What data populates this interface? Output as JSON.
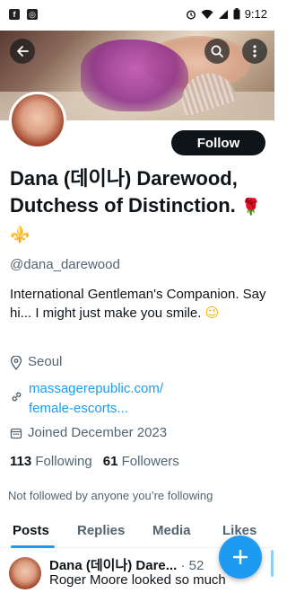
{
  "status_bar": {
    "time": "9:12",
    "left_icons": [
      "facebook-icon",
      "shield-app-icon"
    ],
    "right_icons": [
      "alarm-icon",
      "wifi-icon",
      "signal-icon",
      "battery-icon"
    ]
  },
  "header": {
    "back_icon": "arrow-left-icon",
    "search_icon": "search-icon",
    "more_icon": "more-vertical-icon"
  },
  "profile": {
    "display_name": "Dana (데이나) Darewood, Dutchess of Distinction.",
    "name_emojis": [
      "🌹",
      "⚜️"
    ],
    "follow_label": "Follow",
    "handle": "@dana_darewood",
    "bio": "International Gentleman's Companion.  Say hi... I might just make you smile.",
    "bio_emoji": "😉",
    "location": "Seoul",
    "website_line1": "massagerepublic.com/",
    "website_line2": "female-escorts...",
    "joined": "Joined December 2023",
    "following_count": "113",
    "following_label": "Following",
    "followers_count": "61",
    "followers_label": "Followers",
    "not_followed": "Not followed by anyone you’re following"
  },
  "tabs": [
    {
      "label": "Posts",
      "active": true
    },
    {
      "label": "Replies",
      "active": false
    },
    {
      "label": "Media",
      "active": false
    },
    {
      "label": "Likes",
      "active": false
    }
  ],
  "post": {
    "author": "Dana (데이나) Dare...",
    "time": "· 52",
    "text": "Roger Moore looked so much"
  },
  "fab": {
    "icon": "plus-icon"
  },
  "colors": {
    "accent": "#1d9bf0",
    "text": "#0f1419",
    "muted": "#536471",
    "follow_bg": "#0f1419"
  }
}
